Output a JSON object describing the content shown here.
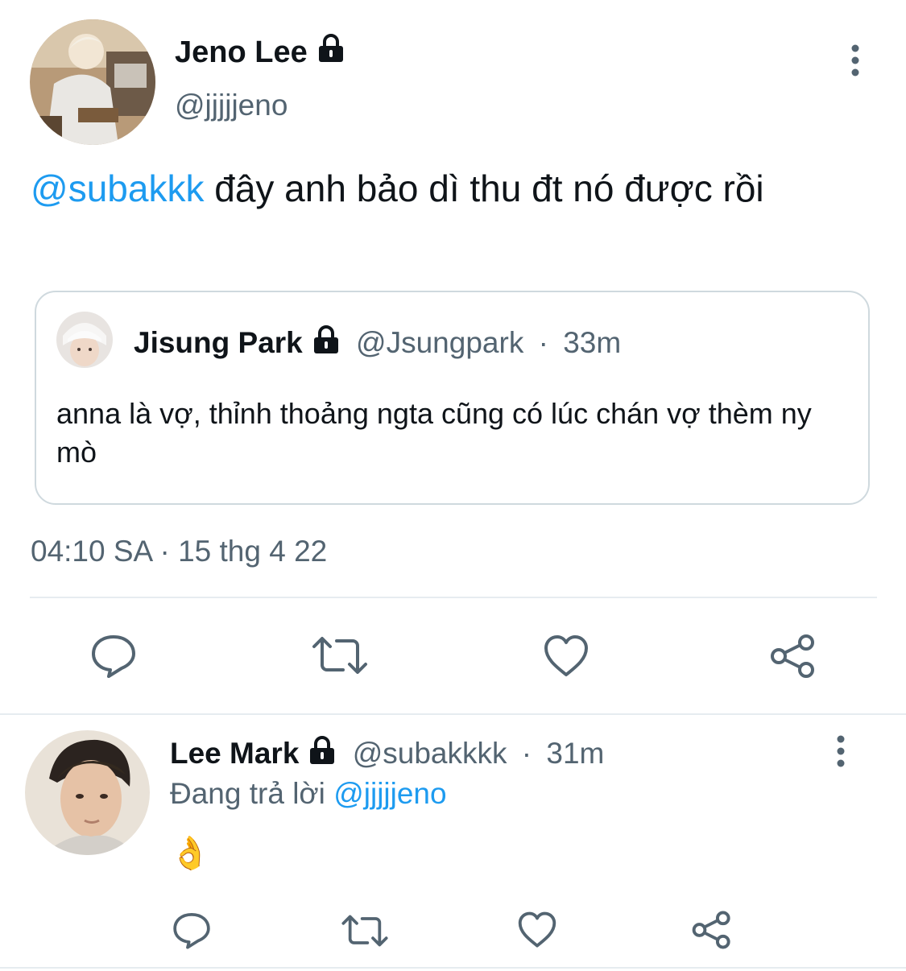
{
  "main_tweet": {
    "author_name": "Jeno Lee",
    "author_handle": "@jjjjjeno",
    "mention": "@subakkk",
    "text": " đây anh bảo dì thu đt nó được rồi",
    "quoted": {
      "author_name": "Jisung Park",
      "author_handle": "@Jsungpark",
      "separator": "·",
      "time": "33m",
      "text": "anna là vợ, thỉnh thoảng ngta cũng có lúc chán vợ thèm ny mò"
    },
    "timestamp": "04:10 SA · 15 thg 4 22",
    "actions": [
      "reply-icon",
      "retweet-icon",
      "like-icon",
      "share-icon"
    ]
  },
  "reply_tweet": {
    "author_name": "Lee Mark",
    "author_handle": "@subakkkk",
    "separator": "·",
    "time": "31m",
    "replying_label": "Đang trả lời ",
    "replying_to": "@jjjjjeno",
    "text": "👌",
    "actions": [
      "reply-icon",
      "retweet-icon",
      "like-icon",
      "share-icon"
    ]
  },
  "colors": {
    "link": "#1d9bf0",
    "muted": "#536471",
    "text": "#0f1419",
    "border": "#cfd9de",
    "divider": "#e6ecf0"
  }
}
